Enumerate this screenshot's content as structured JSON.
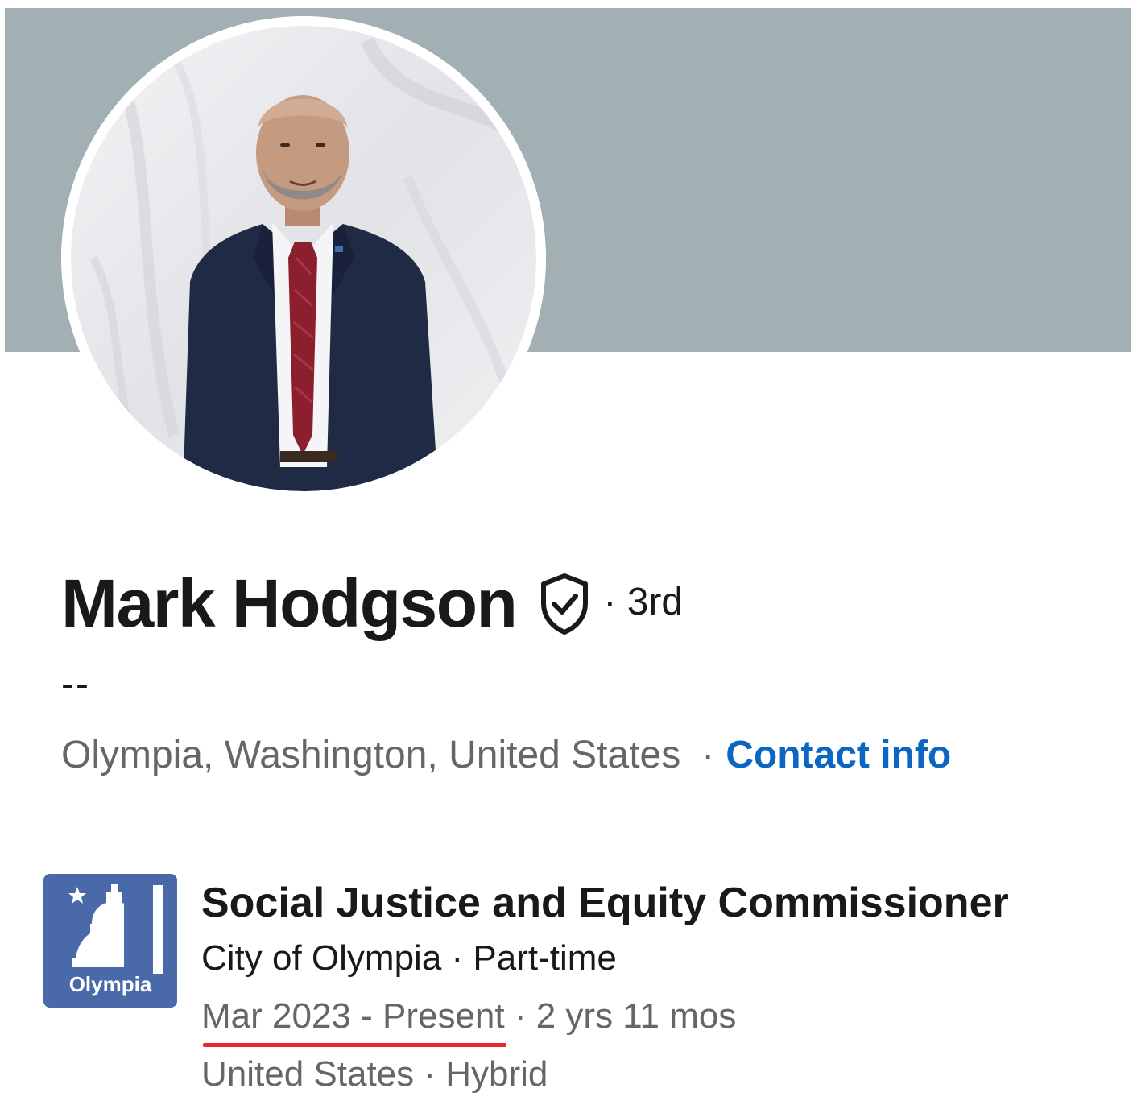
{
  "colors": {
    "cover": "#a2b0b3",
    "link": "#0a66c2",
    "logo_bg": "#4a69a8",
    "highlight_underline": "#e8282d"
  },
  "profile": {
    "name": "Mark Hodgson",
    "verified_icon": "shield-check-icon",
    "degree": "· 3rd",
    "headline": "--",
    "location": "Olympia, Washington, United States",
    "separator": "·",
    "contact_link": "Contact info"
  },
  "experience": {
    "logo_icon": "capitol-dome-icon",
    "logo_text": "Olympia",
    "title": "Social Justice and Equity Commissioner",
    "company": "City of Olympia",
    "employment_type": "· Part-time",
    "dates": "Mar 2023 - Present",
    "duration": "· 2 yrs 11 mos",
    "location_line": "United States · Hybrid"
  }
}
